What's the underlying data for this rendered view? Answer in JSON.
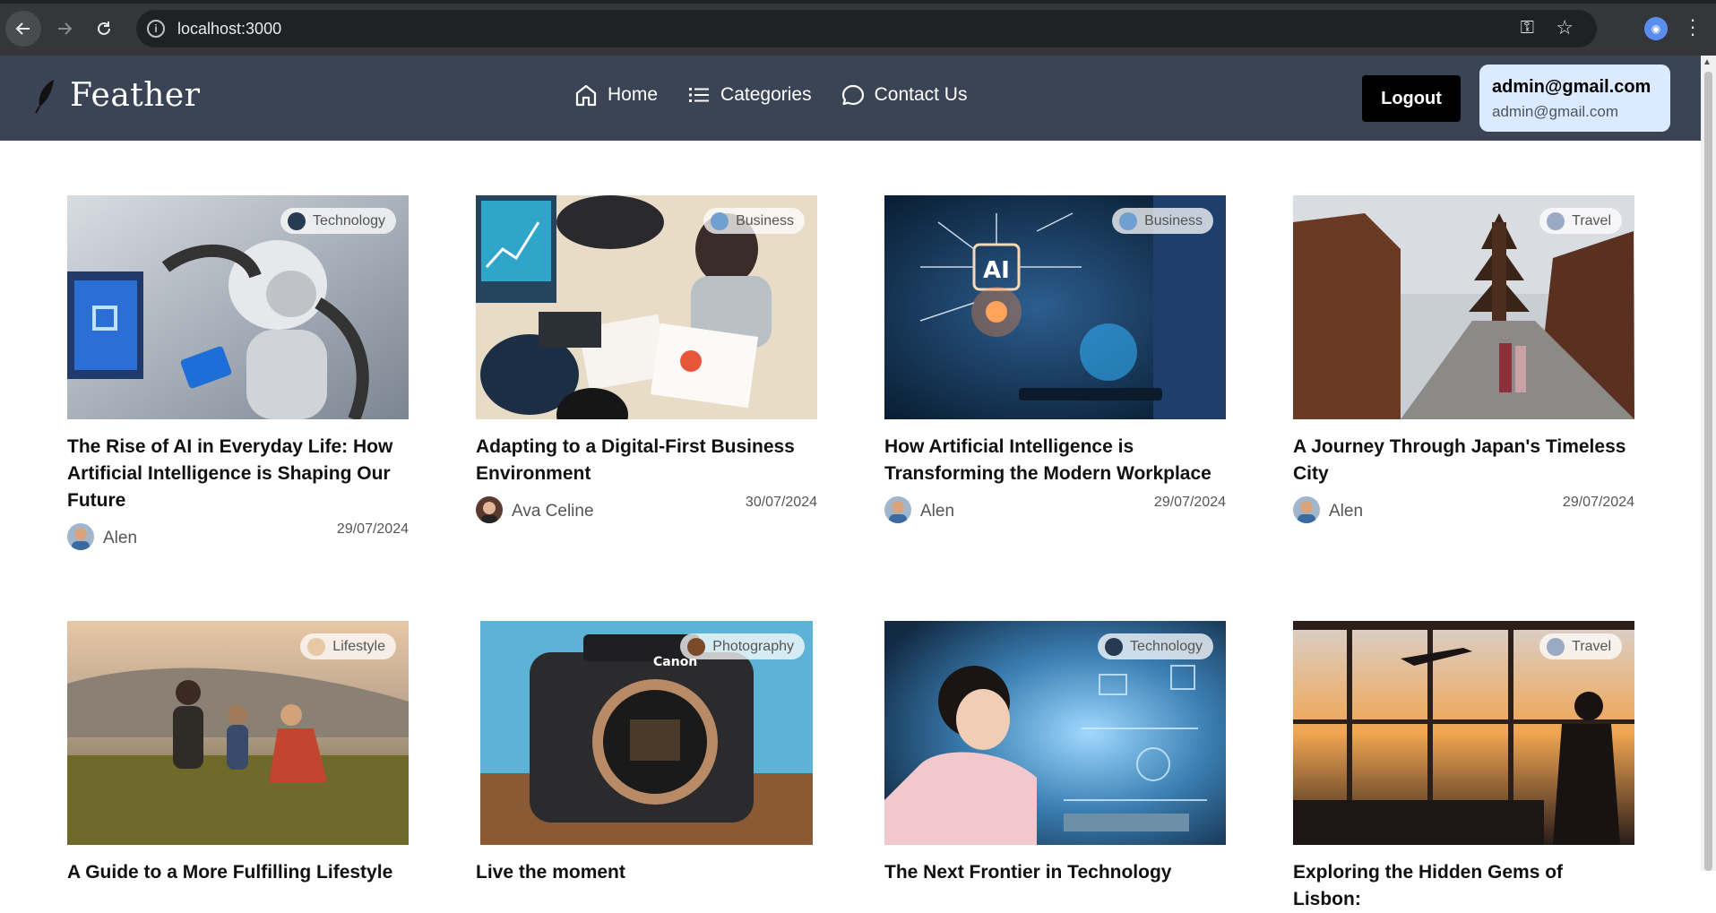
{
  "browser": {
    "url": "localhost:3000",
    "back_icon": "arrow-left-icon",
    "forward_icon": "arrow-right-icon",
    "reload_icon": "reload-icon"
  },
  "header": {
    "brand": "Feather",
    "nav": [
      {
        "label": "Home",
        "icon": "home-icon"
      },
      {
        "label": "Categories",
        "icon": "list-icon"
      },
      {
        "label": "Contact Us",
        "icon": "chat-icon"
      }
    ],
    "logout_label": "Logout",
    "user_name": "admin@gmail.com",
    "user_email": "admin@gmail.com"
  },
  "posts": [
    {
      "title": "The Rise of AI in Everyday Life: How Artificial Intelligence is Shaping Our Future",
      "category": "Technology",
      "author": "Alen",
      "date": "29/07/2024"
    },
    {
      "title": "Adapting to a Digital-First Business Environment",
      "category": "Business",
      "author": "Ava Celine",
      "date": "30/07/2024"
    },
    {
      "title": "How Artificial Intelligence is Transforming the Modern Workplace",
      "category": "Business",
      "author": "Alen",
      "date": "29/07/2024"
    },
    {
      "title": "A Journey Through Japan's Timeless City",
      "category": "Travel",
      "author": "Alen",
      "date": "29/07/2024"
    },
    {
      "title": "A Guide to a More Fulfilling Lifestyle",
      "category": "Lifestyle",
      "author": "",
      "date": ""
    },
    {
      "title": "Live the moment",
      "category": "Photography",
      "author": "",
      "date": ""
    },
    {
      "title": "The Next Frontier in Technology",
      "category": "Technology",
      "author": "",
      "date": ""
    },
    {
      "title": "Exploring the Hidden Gems of Lisbon:",
      "category": "Travel",
      "author": "",
      "date": ""
    }
  ]
}
